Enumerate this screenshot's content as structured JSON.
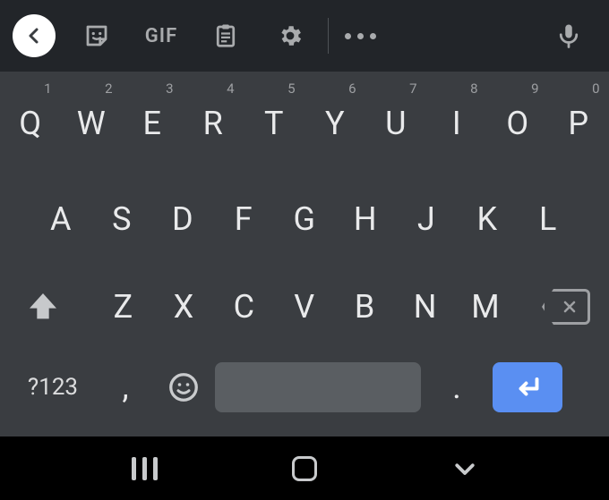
{
  "toolbar": {
    "gif": "GIF"
  },
  "rows": {
    "r1": [
      {
        "l": "Q",
        "s": "1"
      },
      {
        "l": "W",
        "s": "2"
      },
      {
        "l": "E",
        "s": "3"
      },
      {
        "l": "R",
        "s": "4"
      },
      {
        "l": "T",
        "s": "5"
      },
      {
        "l": "Y",
        "s": "6"
      },
      {
        "l": "U",
        "s": "7"
      },
      {
        "l": "I",
        "s": "8"
      },
      {
        "l": "O",
        "s": "9"
      },
      {
        "l": "P",
        "s": "0"
      }
    ],
    "r2": [
      "A",
      "S",
      "D",
      "F",
      "G",
      "H",
      "J",
      "K",
      "L"
    ],
    "r3": [
      "Z",
      "X",
      "C",
      "V",
      "B",
      "N",
      "M"
    ]
  },
  "bottom": {
    "symbols": "?123",
    "comma": ",",
    "period": "."
  }
}
